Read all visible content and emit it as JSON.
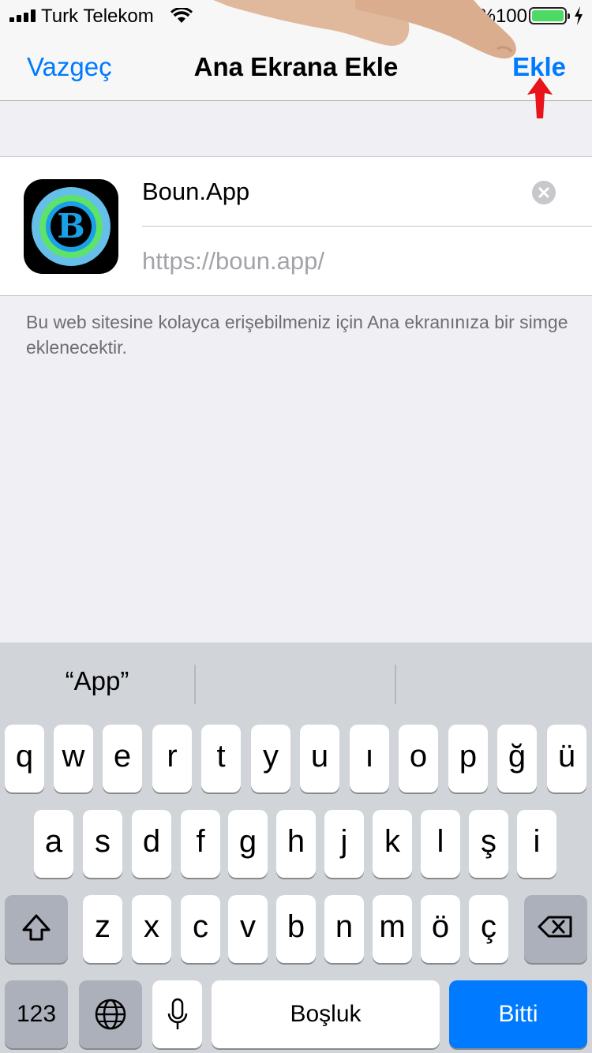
{
  "status_bar": {
    "carrier": "Turk Telekom",
    "battery_percent": "%100"
  },
  "nav": {
    "left_label": "Vazgeç",
    "title": "Ana Ekrana Ekle",
    "right_label": "Ekle"
  },
  "form": {
    "app_icon_letter": "B",
    "name_value": "Boun.App",
    "url_value": "https://boun.app/",
    "footnote": "Bu web sitesine kolayca erişebilmeniz için Ana ekranınıza bir simge eklenecektir."
  },
  "keyboard": {
    "prediction": "“App”",
    "row1": [
      "q",
      "w",
      "e",
      "r",
      "t",
      "y",
      "u",
      "ı",
      "o",
      "p",
      "ğ",
      "ü"
    ],
    "row2": [
      "a",
      "s",
      "d",
      "f",
      "g",
      "h",
      "j",
      "k",
      "l",
      "ş",
      "i"
    ],
    "row3": [
      "z",
      "x",
      "c",
      "v",
      "b",
      "n",
      "m",
      "ö",
      "ç"
    ],
    "numbers_label": "123",
    "space_label": "Boşluk",
    "done_label": "Bitti"
  },
  "colors": {
    "accent": "#007aff",
    "battery": "#4cd964",
    "annotation_arrow": "#e8141b"
  }
}
